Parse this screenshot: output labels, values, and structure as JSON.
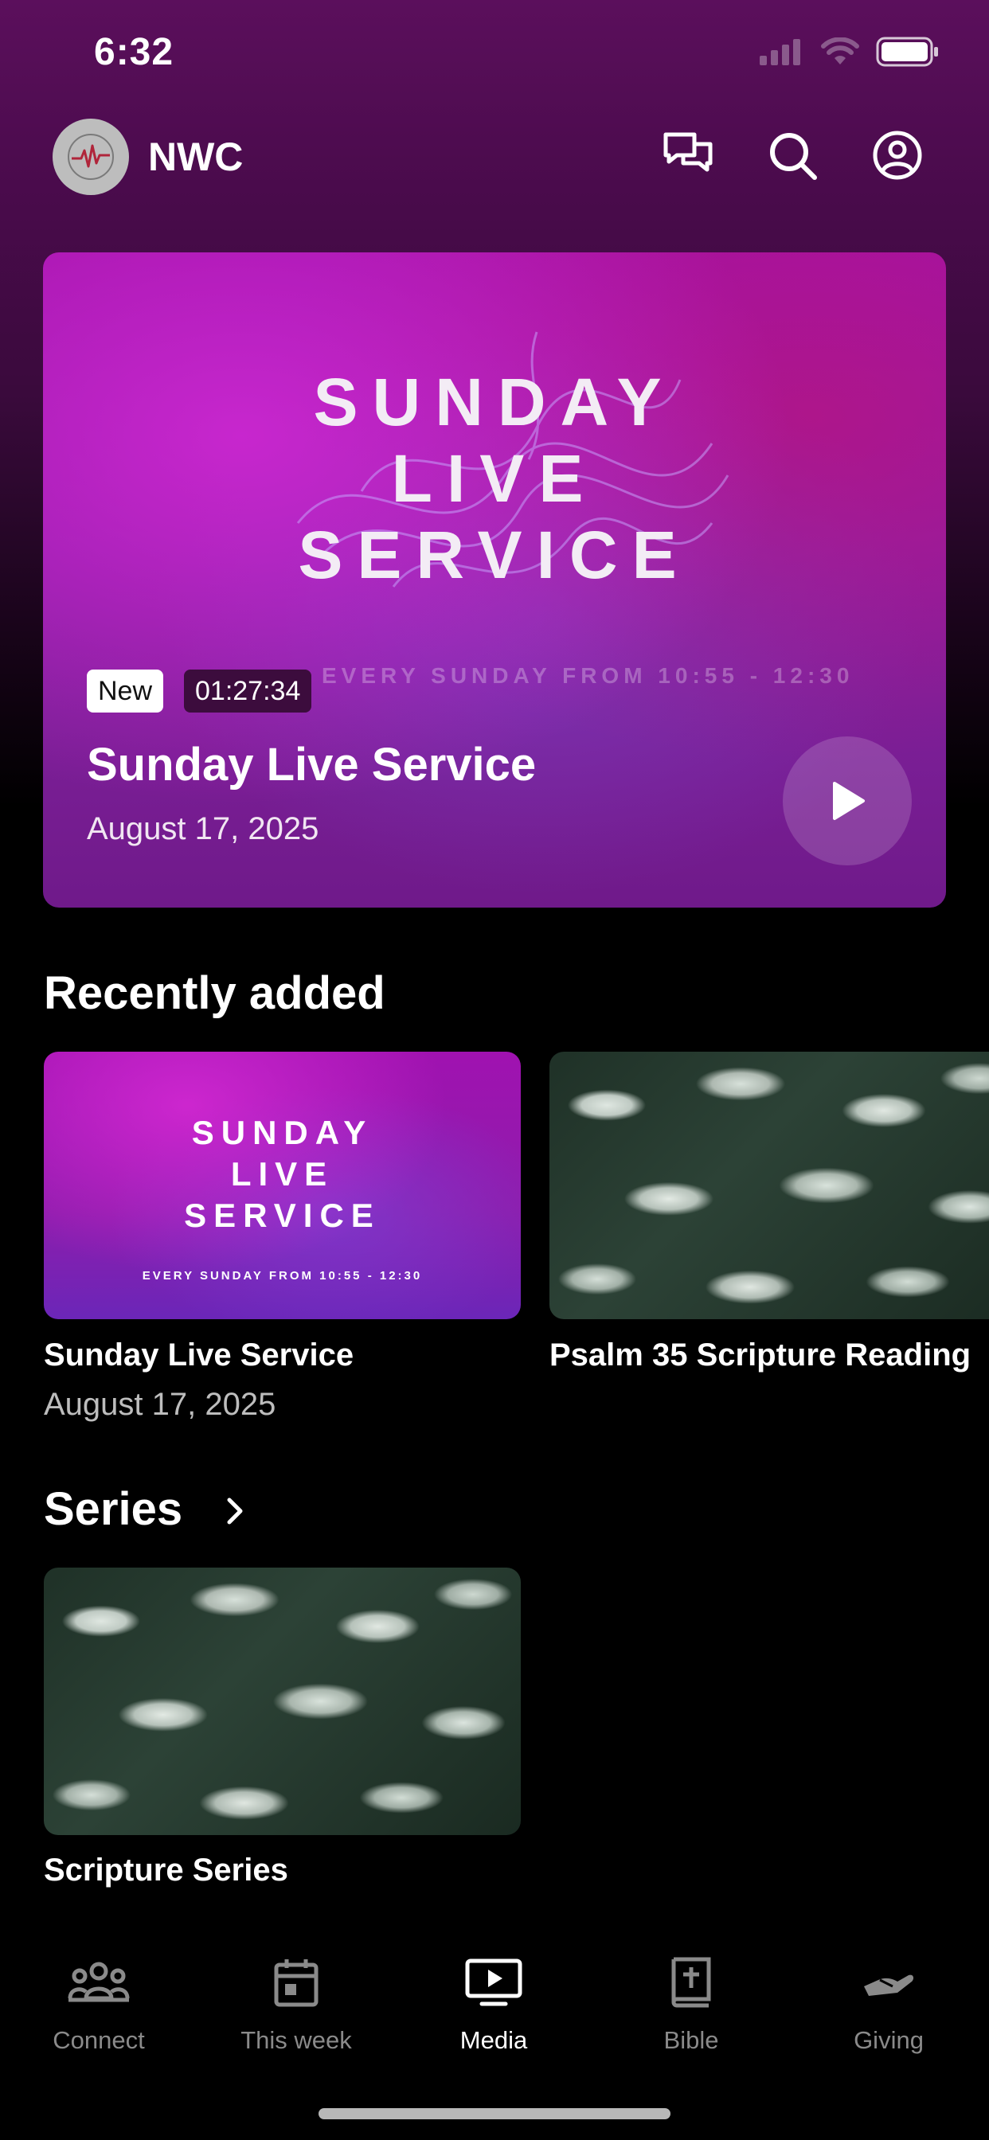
{
  "status_bar": {
    "time": "6:32"
  },
  "header": {
    "brand": "NWC"
  },
  "hero": {
    "art_title_lines": [
      "SUNDAY",
      "LIVE",
      "SERVICE"
    ],
    "art_subtitle": "EVERY SUNDAY FROM 10:55 - 12:30",
    "badge_new": "New",
    "duration": "01:27:34",
    "title": "Sunday Live Service",
    "date": "August 17, 2025"
  },
  "recently_added": {
    "heading": "Recently added",
    "items": [
      {
        "art_title_lines": [
          "SUNDAY",
          "LIVE",
          "SERVICE"
        ],
        "art_subtitle": "EVERY SUNDAY FROM 10:55 - 12:30",
        "title": "Sunday Live Service",
        "date": "August 17, 2025"
      },
      {
        "title": "Psalm 35 Scripture Reading"
      }
    ]
  },
  "series": {
    "heading": "Series",
    "items": [
      {
        "title": "Scripture Series"
      }
    ]
  },
  "tabs": [
    {
      "label": "Connect",
      "icon": "people-icon"
    },
    {
      "label": "This week",
      "icon": "calendar-icon"
    },
    {
      "label": "Media",
      "icon": "tv-play-icon",
      "active": true
    },
    {
      "label": "Bible",
      "icon": "bible-icon"
    },
    {
      "label": "Giving",
      "icon": "hand-icon"
    }
  ],
  "colors": {
    "accent": "#9b1aa6",
    "background": "#000000",
    "tab_inactive": "#8a8a8a"
  }
}
